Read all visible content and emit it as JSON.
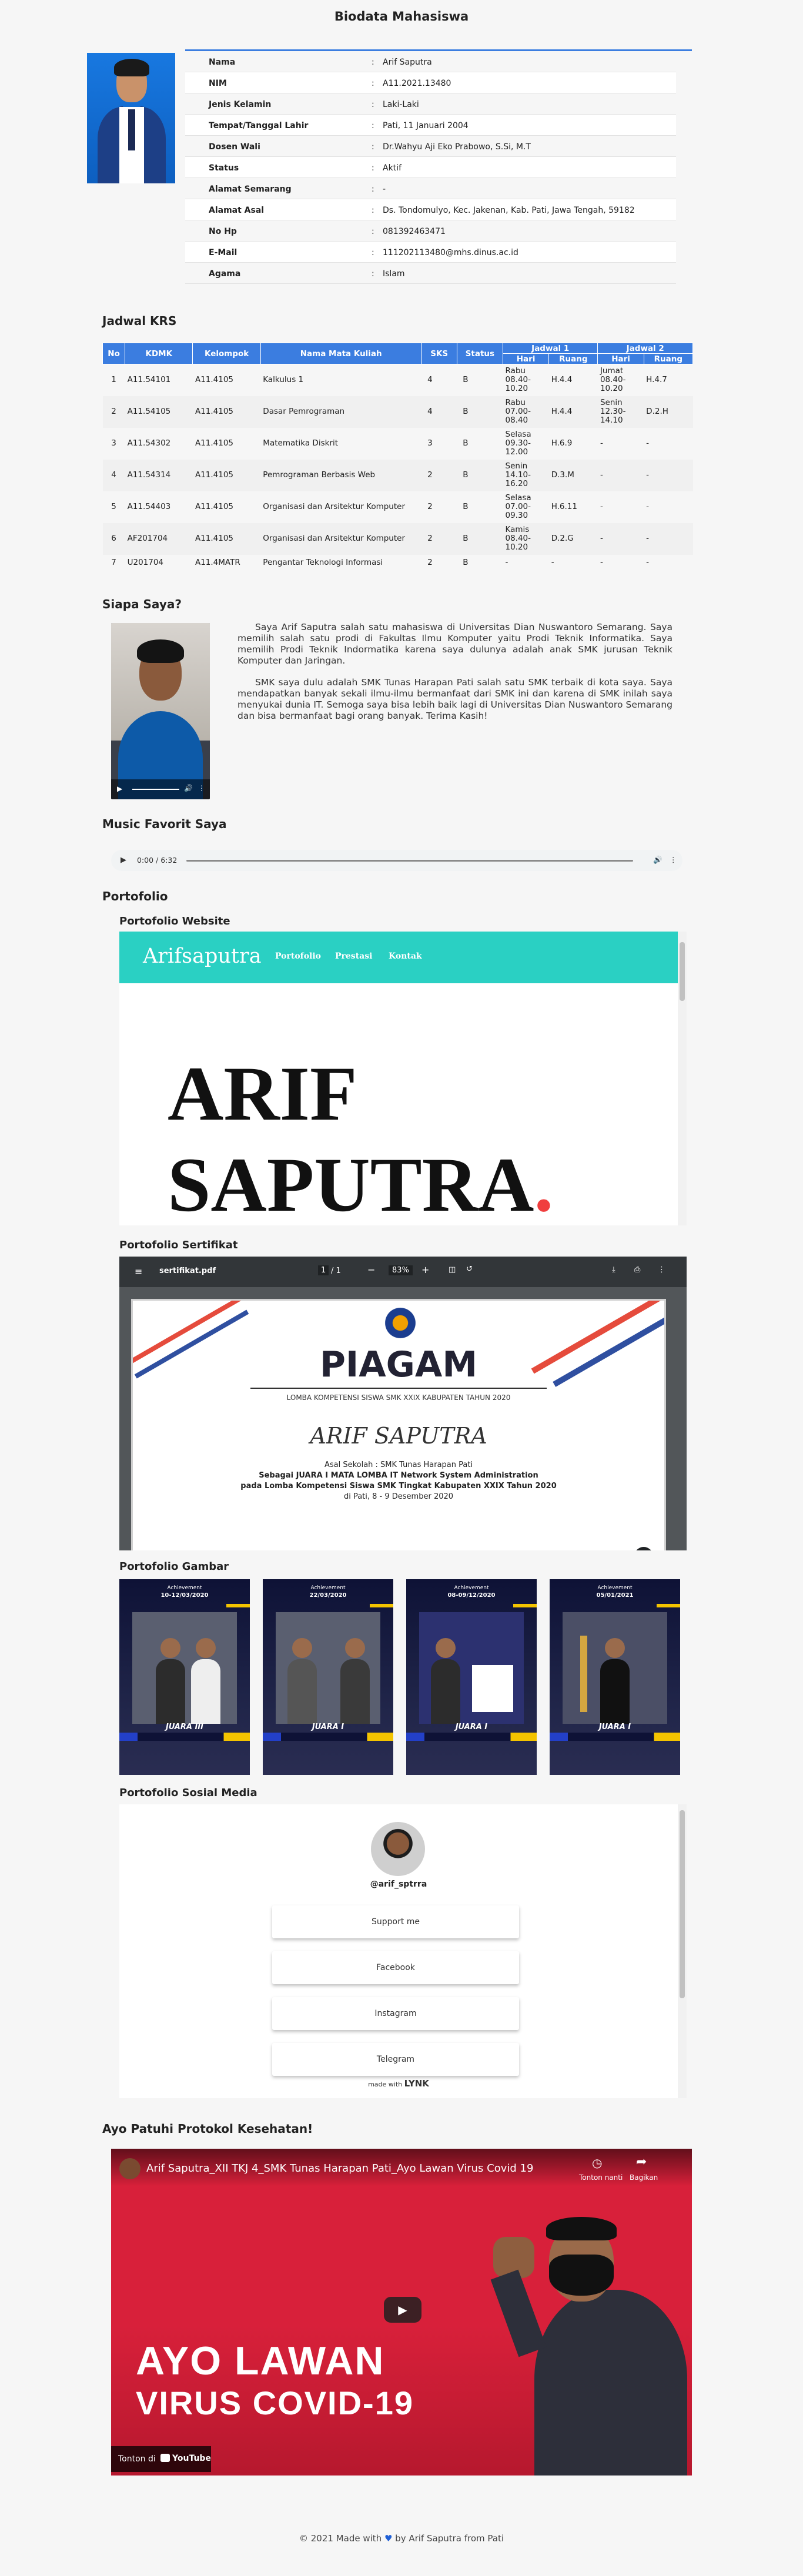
{
  "header": {
    "title": "Biodata Mahasiswa"
  },
  "biodata": [
    {
      "label": "Nama",
      "colon": ":",
      "value": "Arif Saputra"
    },
    {
      "label": "NIM",
      "colon": ":",
      "value": "A11.2021.13480"
    },
    {
      "label": "Jenis Kelamin",
      "colon": ":",
      "value": "Laki-Laki"
    },
    {
      "label": "Tempat/Tanggal Lahir",
      "colon": ":",
      "value": "Pati, 11 Januari 2004"
    },
    {
      "label": "Dosen Wali",
      "colon": ":",
      "value": "Dr.Wahyu Aji Eko Prabowo, S.Si, M.T"
    },
    {
      "label": "Status",
      "colon": ":",
      "value": "Aktif"
    },
    {
      "label": "Alamat Semarang",
      "colon": ":",
      "value": "-"
    },
    {
      "label": "Alamat Asal",
      "colon": ":",
      "value": "Ds. Tondomulyo, Kec. Jakenan, Kab. Pati, Jawa Tengah, 59182"
    },
    {
      "label": "No Hp",
      "colon": ":",
      "value": "081392463471"
    },
    {
      "label": "E-Mail",
      "colon": ":",
      "value": "111202113480@mhs.dinus.ac.id"
    },
    {
      "label": "Agama",
      "colon": ":",
      "value": "Islam"
    }
  ],
  "krs": {
    "title": "Jadwal KRS",
    "headers": {
      "no": "No",
      "kdmk": "KDMK",
      "kelompok": "Kelompok",
      "nama": "Nama Mata Kuliah",
      "sks": "SKS",
      "status": "Status",
      "jadwal1": "Jadwal 1",
      "jadwal2": "Jadwal 2",
      "hari": "Hari",
      "ruang": "Ruang"
    },
    "rows": [
      {
        "no": "1",
        "kdmk": "A11.54101",
        "kelompok": "A11.4105",
        "nama": "Kalkulus 1",
        "sks": "4",
        "status": "B",
        "hari1": "Rabu 08.40-10.20",
        "ruang1": "H.4.4",
        "hari2": "Jumat 08.40-10.20",
        "ruang2": "H.4.7"
      },
      {
        "no": "2",
        "kdmk": "A11.54105",
        "kelompok": "A11.4105",
        "nama": "Dasar Pemrograman",
        "sks": "4",
        "status": "B",
        "hari1": "Rabu 07.00-08.40",
        "ruang1": "H.4.4",
        "hari2": "Senin 12.30-14.10",
        "ruang2": "D.2.H"
      },
      {
        "no": "3",
        "kdmk": "A11.54302",
        "kelompok": "A11.4105",
        "nama": "Matematika Diskrit",
        "sks": "3",
        "status": "B",
        "hari1": "Selasa 09.30-12.00",
        "ruang1": "H.6.9",
        "hari2": "-",
        "ruang2": "-"
      },
      {
        "no": "4",
        "kdmk": "A11.54314",
        "kelompok": "A11.4105",
        "nama": "Pemrograman Berbasis Web",
        "sks": "2",
        "status": "B",
        "hari1": "Senin 14.10-16.20",
        "ruang1": "D.3.M",
        "hari2": "-",
        "ruang2": "-"
      },
      {
        "no": "5",
        "kdmk": "A11.54403",
        "kelompok": "A11.4105",
        "nama": "Organisasi dan Arsitektur Komputer",
        "sks": "2",
        "status": "B",
        "hari1": "Selasa 07.00-09.30",
        "ruang1": "H.6.11",
        "hari2": "-",
        "ruang2": "-"
      },
      {
        "no": "6",
        "kdmk": "AF201704",
        "kelompok": "A11.4105",
        "nama": "Organisasi dan Arsitektur Komputer",
        "sks": "2",
        "status": "B",
        "hari1": "Kamis 08.40-10.20",
        "ruang1": "D.2.G",
        "hari2": "-",
        "ruang2": "-"
      },
      {
        "no": "7",
        "kdmk": "U201704",
        "kelompok": "A11.4MATR",
        "nama": "Pengantar Teknologi Informasi",
        "sks": "2",
        "status": "B",
        "hari1": "-",
        "ruang1": "-",
        "hari2": "-",
        "ruang2": "-"
      }
    ]
  },
  "about": {
    "title": "Siapa Saya?",
    "p1": "Saya Arif Saputra salah satu mahasiswa di Universitas Dian Nuswantoro Semarang. Saya memilih salah satu prodi di Fakultas Ilmu Komputer yaitu Prodi Teknik Informatika. Saya memilih Prodi Teknik Indormatika karena saya dulunya adalah anak SMK jurusan Teknik Komputer dan Jaringan.",
    "p2": "SMK saya dulu adalah SMK Tunas Harapan Pati salah satu SMK terbaik di kota saya. Saya mendapatkan banyak sekali ilmu-ilmu bermanfaat dari SMK ini dan karena di SMK inilah saya menyukai dunia IT. Semoga saya bisa lebih baik lagi di Universitas Dian Nuswantoro Semarang dan bisa bermanfaat bagi orang banyak. Terima Kasih!"
  },
  "music": {
    "title": "Music Favorit Saya",
    "time": "0:00 / 6:32"
  },
  "portfolio": {
    "title": "Portofolio",
    "website": {
      "title": "Portofolio Website",
      "logo": "Arifsaputra",
      "nav": [
        "Portofolio",
        "Prestasi",
        "Kontak"
      ],
      "hero_line1": "ARIF",
      "hero_line2": "SAPUTRA",
      "hero_dot": "."
    },
    "certificate": {
      "title": "Portofolio Sertifikat",
      "filename": "sertifikat.pdf",
      "page": "1",
      "pages": "/ 1",
      "zoom": "83%",
      "piagam": "PIAGAM",
      "event": "LOMBA KOMPETENSI SISWA SMK XXIX KABUPATEN TAHUN 2020",
      "name": "ARIF SAPUTRA",
      "line1": "Asal Sekolah : SMK Tunas Harapan Pati",
      "line2": "Sebagai JUARA I MATA LOMBA IT Network System Administration",
      "line3": "pada Lomba Kompetensi Siswa SMK Tingkat Kabupaten XXIX Tahun 2020",
      "line4": "di Pati, 8 - 9 Desember 2020"
    },
    "gallery": {
      "title": "Portofolio Gambar",
      "items": [
        {
          "top": "Achievement",
          "date": "10-12/03/2020",
          "juara": "JUARA III"
        },
        {
          "top": "Achievement",
          "date": "22/03/2020",
          "juara": "JUARA I"
        },
        {
          "top": "Achievement",
          "date": "08-09/12/2020",
          "juara": "JUARA I"
        },
        {
          "top": "Achievement",
          "date": "05/01/2021",
          "juara": "JUARA I"
        }
      ]
    },
    "social": {
      "title": "Portofolio Sosial Media",
      "handle": "@arif_sptrra",
      "buttons": [
        "Support me",
        "Facebook",
        "Instagram",
        "Telegram"
      ],
      "made_with": "made with",
      "brand": "LYNK"
    }
  },
  "health": {
    "title": "Ayo Patuhi Protokol Kesehatan!",
    "video_title": "Arif Saputra_XII TKJ 4_SMK Tunas Harapan Pati_Ayo Lawan Virus Covid 19",
    "watch_later": "Tonton nanti",
    "share": "Bagikan",
    "big1": "AYO LAWAN",
    "big2": "VIRUS COVID-19",
    "watch_on": "Tonton di",
    "youtube": "YouTube"
  },
  "footer": {
    "pre": "© 2021 Made with",
    "heart": "♥",
    "post": "by Arif Saputra from Pati"
  },
  "colors": {
    "accent": "#3b7de0",
    "teal": "#2ad0c3",
    "youtube_red": "#d8203a"
  }
}
